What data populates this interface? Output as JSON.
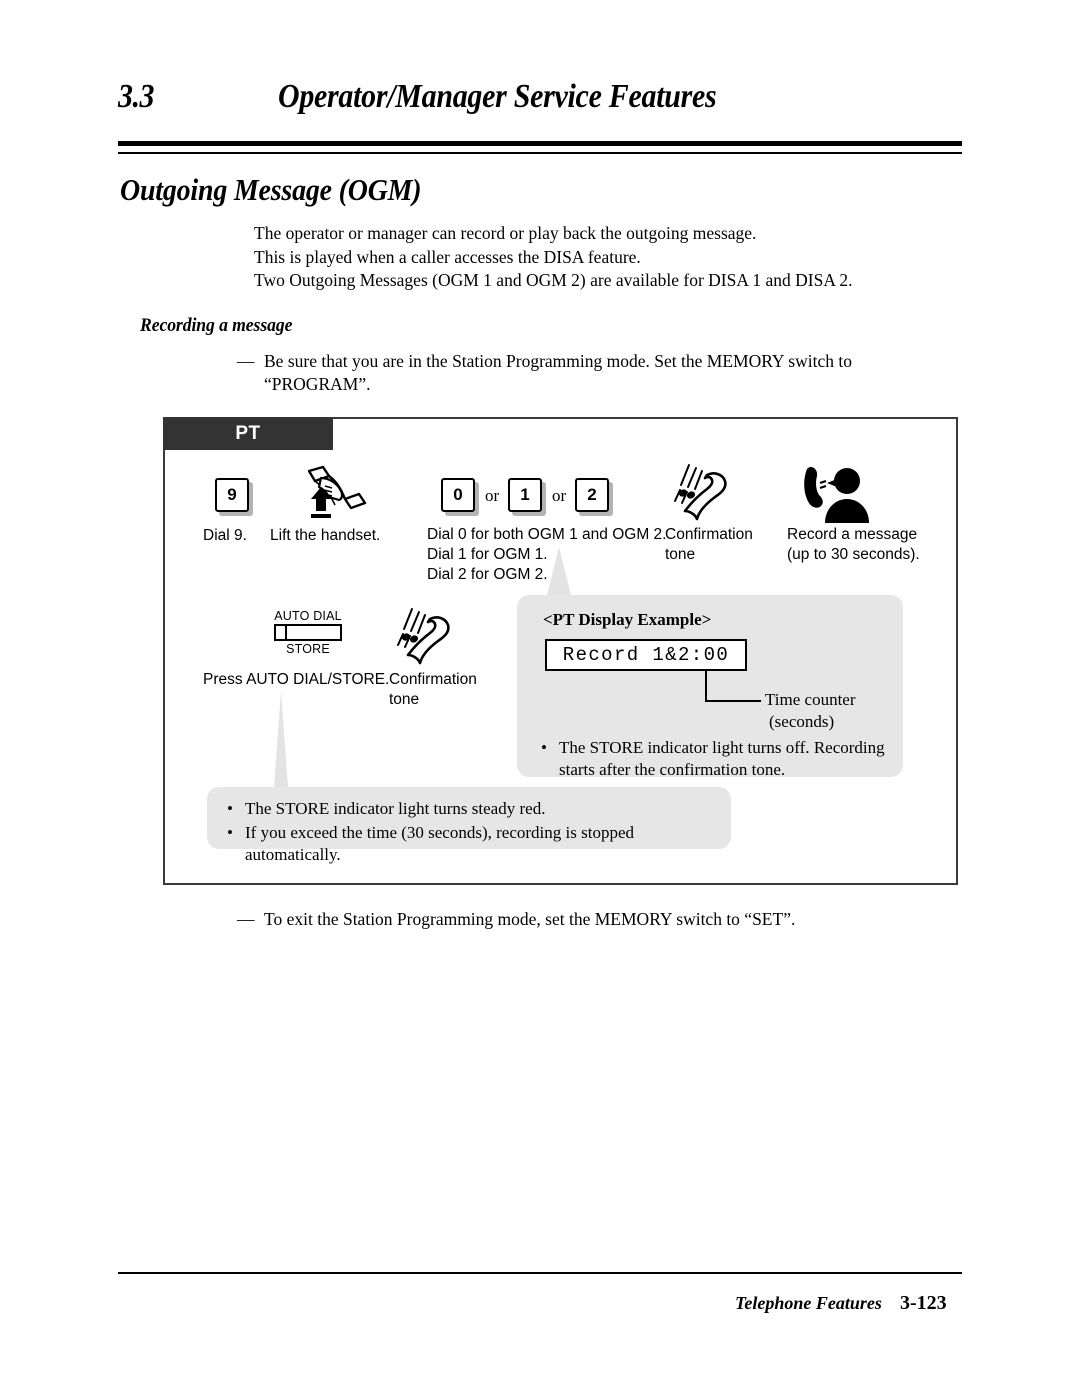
{
  "header": {
    "section_number": "3.3",
    "section_title": "Operator/Manager Service Features",
    "feature_title": "Outgoing Message (OGM)"
  },
  "intro": {
    "line1": "The operator or manager can record or play back the outgoing message.",
    "line2": "This is played when a caller accesses the DISA feature.",
    "line3": "Two Outgoing Messages (OGM 1 and OGM 2) are available for DISA 1 and DISA 2."
  },
  "subsection": {
    "heading": "Recording a message",
    "dash": "—",
    "precondition": "Be sure that you are in the Station Programming mode. Set the MEMORY switch to “PROGRAM”."
  },
  "diagram": {
    "tab_label": "PT",
    "steps": {
      "dial9": {
        "key": "9",
        "caption": "Dial 9."
      },
      "lift": {
        "caption": "Lift the handset."
      },
      "ogm_keys": {
        "key0": "0",
        "key1": "1",
        "key2": "2",
        "or1": "or",
        "or2": "or",
        "caption": "Dial 0 for both OGM 1 and OGM 2.\nDial 1 for OGM 1.\nDial 2 for OGM 2."
      },
      "tone1": {
        "caption": "Confirmation\ntone"
      },
      "record": {
        "caption": "Record a message\n(up to 30 seconds)."
      },
      "store": {
        "button_top": "AUTO DIAL",
        "button_bottom": "STORE",
        "caption": "Press AUTO DIAL/STORE."
      },
      "tone2": {
        "caption": "Confirmation\ntone"
      }
    },
    "display_callout": {
      "title": "<PT Display Example>",
      "lcd_text": "Record 1&2:00",
      "leader_label_line1": "Time counter",
      "leader_label_line2": "(seconds)",
      "bullet": "•",
      "note": "The STORE indicator light turns off. Recording starts after the confirmation tone."
    },
    "store_callout": {
      "bullet": "•",
      "note1": "The STORE indicator light turns steady red.",
      "note2": "If you exceed the time (30 seconds), recording is stopped automatically."
    }
  },
  "closing": {
    "dash": "—",
    "text": "To exit the Station Programming mode, set the MEMORY switch to “SET”."
  },
  "footer": {
    "manual_name": "Telephone Features",
    "page_number": "3-123"
  }
}
